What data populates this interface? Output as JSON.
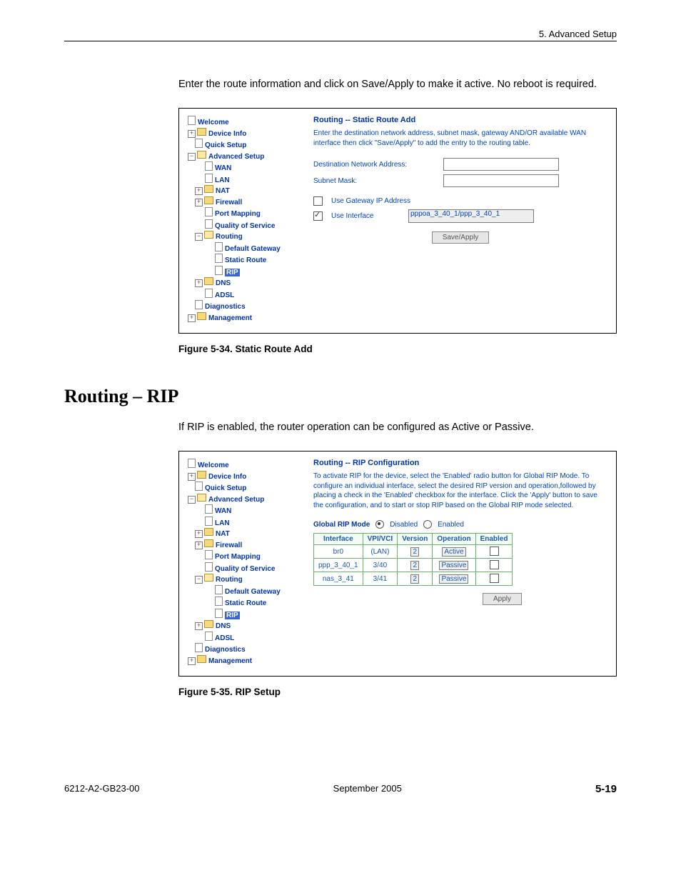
{
  "page": {
    "header": "5. Advanced Setup",
    "intro1": "Enter the route information and click on Save/Apply to make it active. No reboot is required.",
    "section_heading": "Routing – RIP",
    "intro2": "If RIP is enabled, the router operation can be configured as Active or Passive.",
    "fig1": "Figure 5-34.    Static Route Add",
    "fig2": "Figure 5-35.    RIP Setup",
    "footer_left": "6212-A2-GB23-00",
    "footer_center": "September 2005",
    "footer_right": "5-19"
  },
  "icons": {
    "expand_plus": "+",
    "expand_minus": "−"
  },
  "tree": {
    "welcome": "Welcome",
    "device_info": "Device Info",
    "quick_setup": "Quick Setup",
    "advanced_setup": "Advanced Setup",
    "wan": "WAN",
    "lan": "LAN",
    "nat": "NAT",
    "firewall": "Firewall",
    "port_mapping": "Port Mapping",
    "qos": "Quality of Service",
    "routing": "Routing",
    "default_gateway": "Default Gateway",
    "static_route": "Static Route",
    "rip": "RIP",
    "dns": "DNS",
    "adsl": "ADSL",
    "diagnostics": "Diagnostics",
    "management": "Management"
  },
  "fig1pane": {
    "title": "Routing -- Static Route Add",
    "desc": "Enter the destination network address, subnet mask, gateway AND/OR available WAN interface then click \"Save/Apply\" to add the entry to the routing table.",
    "dest_label": "Destination Network Address:",
    "mask_label": "Subnet Mask:",
    "gw_label": "Use Gateway IP Address",
    "if_label": "Use Interface",
    "if_value": "pppoa_3_40_1/ppp_3_40_1",
    "button": "Save/Apply"
  },
  "fig2pane": {
    "title": "Routing -- RIP Configuration",
    "desc": "To activate RIP for the device, select the 'Enabled' radio button for Global RIP Mode. To configure an individual interface, select the desired RIP version and operation,followed by placing a check in the 'Enabled' checkbox for the interface. Click the 'Apply' button to save the configuration, and to start or stop RIP based on the Global RIP mode selected.",
    "mode_label": "Global RIP Mode",
    "disabled": "Disabled",
    "enabled": "Enabled",
    "cols": {
      "iface": "Interface",
      "vpivci": "VPI/VCI",
      "version": "Version",
      "operation": "Operation",
      "en": "Enabled"
    },
    "rows": [
      {
        "iface": "br0",
        "vpivci": "(LAN)",
        "version": "2",
        "operation": "Active"
      },
      {
        "iface": "ppp_3_40_1",
        "vpivci": "3/40",
        "version": "2",
        "operation": "Passive"
      },
      {
        "iface": "nas_3_41",
        "vpivci": "3/41",
        "version": "2",
        "operation": "Passive"
      }
    ],
    "button": "Apply"
  }
}
